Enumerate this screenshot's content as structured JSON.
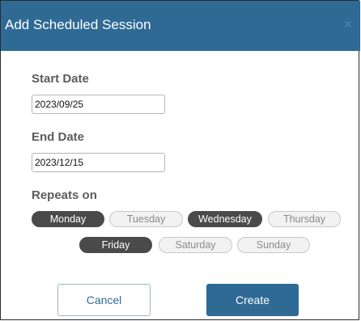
{
  "dialog": {
    "title": "Add Scheduled Session",
    "close_icon": "×"
  },
  "form": {
    "start_date_label": "Start Date",
    "start_date_value": "2023/09/25",
    "end_date_label": "End Date",
    "end_date_value": "2023/12/15",
    "repeats_label": "Repeats on"
  },
  "days": [
    {
      "label": "Monday",
      "selected": true
    },
    {
      "label": "Tuesday",
      "selected": false
    },
    {
      "label": "Wednesday",
      "selected": true
    },
    {
      "label": "Thursday",
      "selected": false
    },
    {
      "label": "Friday",
      "selected": true
    },
    {
      "label": "Saturday",
      "selected": false
    },
    {
      "label": "Sunday",
      "selected": false
    }
  ],
  "buttons": {
    "cancel_label": "Cancel",
    "create_label": "Create"
  },
  "colors": {
    "header": "#2f6a95",
    "selected_pill": "#4a4a4a",
    "unselected_pill": "#f2f2f2"
  }
}
